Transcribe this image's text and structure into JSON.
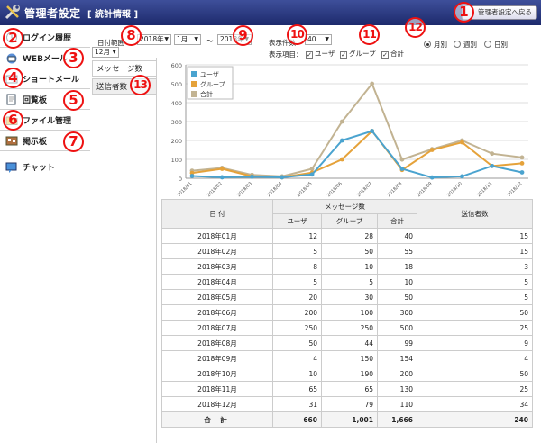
{
  "header": {
    "title": "管理者設定",
    "subtitle": "[ 統計情報 ]",
    "back_label": "管理者設定へ戻る"
  },
  "sidebar": {
    "items": [
      {
        "label": "ログイン履歴",
        "icon": "history-icon"
      },
      {
        "label": "WEBメール",
        "icon": "mail-icon"
      },
      {
        "label": "ショートメール",
        "icon": "short-mail-icon"
      },
      {
        "label": "回覧板",
        "icon": "circular-icon"
      },
      {
        "label": "ファイル管理",
        "icon": "folder-icon"
      },
      {
        "label": "掲示板",
        "icon": "board-icon"
      },
      {
        "label": "チャット",
        "icon": "chat-icon"
      }
    ]
  },
  "tabs": {
    "message": "メッセージ数",
    "sender": "送信者数"
  },
  "controls": {
    "period_label": "日付範囲",
    "start_year": "2018年",
    "start_month": "1月",
    "tilde": "～",
    "end_year": "2018年",
    "end_month": "12月",
    "count_label": "表示件数",
    "count_value": "40",
    "items_label": "表示項目：",
    "check_user": "ユーザ",
    "check_group": "グループ",
    "check_total": "合計",
    "radio_monthly": "月別",
    "radio_weekly": "週別",
    "radio_daily": "日別"
  },
  "badges": [
    "1",
    "2",
    "3",
    "4",
    "5",
    "6",
    "7",
    "8",
    "9",
    "10",
    "11",
    "12",
    "13"
  ],
  "colors": {
    "header": "#2a3a82",
    "user": "#4aa3cf",
    "group": "#e5a23a",
    "total": "#c2b392",
    "badge": "#e11111"
  },
  "chart_data": {
    "type": "line",
    "categories": [
      "2018/01",
      "2018/02",
      "2018/03",
      "2018/04",
      "2018/05",
      "2018/06",
      "2018/07",
      "2018/08",
      "2018/09",
      "2018/10",
      "2018/11",
      "2018/12"
    ],
    "series": [
      {
        "name": "ユーザ",
        "values": [
          12,
          5,
          8,
          5,
          20,
          200,
          250,
          50,
          4,
          10,
          65,
          31
        ]
      },
      {
        "name": "グループ",
        "values": [
          28,
          50,
          10,
          5,
          30,
          100,
          250,
          44,
          150,
          190,
          65,
          79
        ]
      },
      {
        "name": "合計",
        "values": [
          40,
          55,
          18,
          10,
          50,
          300,
          500,
          99,
          154,
          200,
          130,
          110
        ]
      }
    ],
    "yticks": [
      0,
      100,
      200,
      300,
      400,
      500,
      600
    ],
    "ylim": [
      0,
      600
    ],
    "grid": true,
    "legend": "top-left"
  },
  "table": {
    "headers": {
      "date": "日 付",
      "messages": "メッセージ数",
      "user": "ユーザ",
      "group": "グループ",
      "total": "合計",
      "senders": "送信者数"
    },
    "rows": [
      {
        "date": "2018年01月",
        "user": "12",
        "group": "28",
        "total": "40",
        "senders": "15"
      },
      {
        "date": "2018年02月",
        "user": "5",
        "group": "50",
        "total": "55",
        "senders": "15"
      },
      {
        "date": "2018年03月",
        "user": "8",
        "group": "10",
        "total": "18",
        "senders": "3"
      },
      {
        "date": "2018年04月",
        "user": "5",
        "group": "5",
        "total": "10",
        "senders": "5"
      },
      {
        "date": "2018年05月",
        "user": "20",
        "group": "30",
        "total": "50",
        "senders": "5"
      },
      {
        "date": "2018年06月",
        "user": "200",
        "group": "100",
        "total": "300",
        "senders": "50"
      },
      {
        "date": "2018年07月",
        "user": "250",
        "group": "250",
        "total": "500",
        "senders": "25"
      },
      {
        "date": "2018年08月",
        "user": "50",
        "group": "44",
        "total": "99",
        "senders": "9"
      },
      {
        "date": "2018年09月",
        "user": "4",
        "group": "150",
        "total": "154",
        "senders": "4"
      },
      {
        "date": "2018年10月",
        "user": "10",
        "group": "190",
        "total": "200",
        "senders": "50"
      },
      {
        "date": "2018年11月",
        "user": "65",
        "group": "65",
        "total": "130",
        "senders": "25"
      },
      {
        "date": "2018年12月",
        "user": "31",
        "group": "79",
        "total": "110",
        "senders": "34"
      }
    ],
    "footer": {
      "label": "合 計",
      "user": "660",
      "group": "1,001",
      "total": "1,666",
      "senders": "240"
    }
  }
}
